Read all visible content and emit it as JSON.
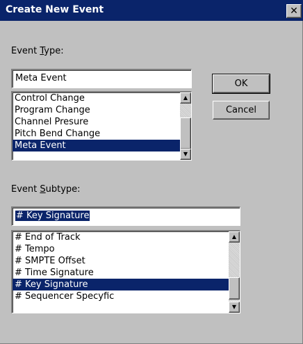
{
  "window": {
    "title": "Create New Event",
    "close_glyph": "✕"
  },
  "event_type": {
    "label_prefix": "Event ",
    "label_accel": "T",
    "label_suffix": "ype:",
    "value": "Meta Event",
    "items": [
      "Control Change",
      "Program Change",
      "Channel Presure",
      "Pitch Bend Change",
      "Meta Event"
    ],
    "selected_index": 4
  },
  "event_subtype": {
    "label_prefix": "Event ",
    "label_accel": "S",
    "label_suffix": "ubtype:",
    "value": "# Key Signature",
    "items": [
      "# End of Track",
      "# Tempo",
      "# SMPTE Offset",
      "# Time Signature",
      "# Key Signature",
      "# Sequencer Specyfic"
    ],
    "selected_index": 4
  },
  "buttons": {
    "ok": "OK",
    "cancel": "Cancel"
  },
  "scroll_arrows": {
    "up": "▲",
    "down": "▼"
  },
  "colors": {
    "title_bar": "#0a246a",
    "selection": "#0a246a",
    "face": "#c0c0c0"
  }
}
